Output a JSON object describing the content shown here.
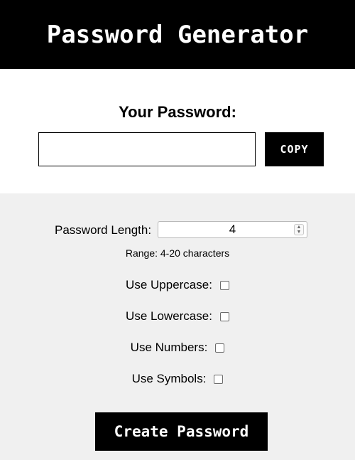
{
  "header": {
    "title": "Password Generator"
  },
  "output": {
    "title": "Your Password:",
    "password_value": "",
    "copy_label": "COPY"
  },
  "options": {
    "length_label": "Password Length:",
    "length_value": "4",
    "range_note": "Range: 4-20 characters",
    "checkboxes": [
      {
        "label": "Use Uppercase:",
        "checked": false
      },
      {
        "label": "Use Lowercase:",
        "checked": false
      },
      {
        "label": "Use Numbers:",
        "checked": false
      },
      {
        "label": "Use Symbols:",
        "checked": false
      }
    ],
    "create_label": "Create Password"
  }
}
